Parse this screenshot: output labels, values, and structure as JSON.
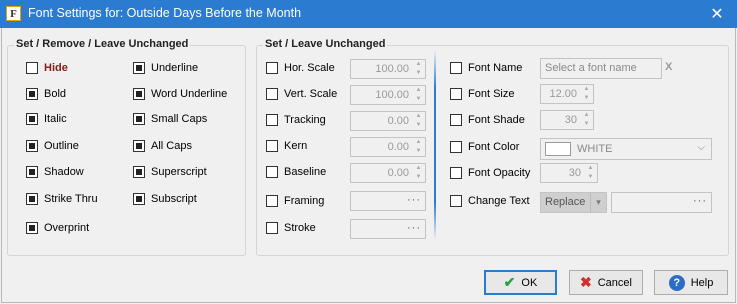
{
  "window": {
    "title": "Font Settings for: Outside Days Before the Month",
    "app_icon_glyph": "F",
    "close_glyph": "✕"
  },
  "group_left": {
    "legend": "Set / Remove / Leave Unchanged",
    "items": [
      {
        "label": "Hide",
        "state": "empty",
        "emphasis": true
      },
      {
        "label": "Underline",
        "state": "filled"
      },
      {
        "label": "Bold",
        "state": "filled"
      },
      {
        "label": "Word Underline",
        "state": "filled"
      },
      {
        "label": "Italic",
        "state": "filled"
      },
      {
        "label": "Small Caps",
        "state": "filled"
      },
      {
        "label": "Outline",
        "state": "filled"
      },
      {
        "label": "All Caps",
        "state": "filled"
      },
      {
        "label": "Shadow",
        "state": "filled"
      },
      {
        "label": "Superscript",
        "state": "filled"
      },
      {
        "label": "Strike Thru",
        "state": "filled"
      },
      {
        "label": "Subscript",
        "state": "filled"
      },
      {
        "label": "Overprint",
        "state": "filled"
      }
    ]
  },
  "group_right": {
    "legend": "Set / Leave Unchanged",
    "hor_scale": {
      "label": "Hor. Scale",
      "value": "100.00"
    },
    "vert_scale": {
      "label": "Vert. Scale",
      "value": "100.00"
    },
    "tracking": {
      "label": "Tracking",
      "value": "0.00"
    },
    "kern": {
      "label": "Kern",
      "value": "0.00"
    },
    "baseline": {
      "label": "Baseline",
      "value": "0.00"
    },
    "framing": {
      "label": "Framing",
      "button": "···"
    },
    "stroke": {
      "label": "Stroke",
      "button": "···"
    },
    "font_name": {
      "label": "Font Name",
      "placeholder": "Select a font name",
      "clear": "X"
    },
    "font_size": {
      "label": "Font Size",
      "value": "12.00"
    },
    "font_shade": {
      "label": "Font Shade",
      "value": "30"
    },
    "font_color": {
      "label": "Font Color",
      "value": "WHITE",
      "swatch": "#ffffff"
    },
    "font_opacity": {
      "label": "Font Opacity",
      "value": "30"
    },
    "change_text": {
      "label": "Change Text",
      "mode": "Replace",
      "button": "···"
    }
  },
  "buttons": {
    "ok": "OK",
    "cancel": "Cancel",
    "help": "Help"
  },
  "colors": {
    "titlebar": "#2b7bd1",
    "hide_label": "#8b1a1a"
  }
}
